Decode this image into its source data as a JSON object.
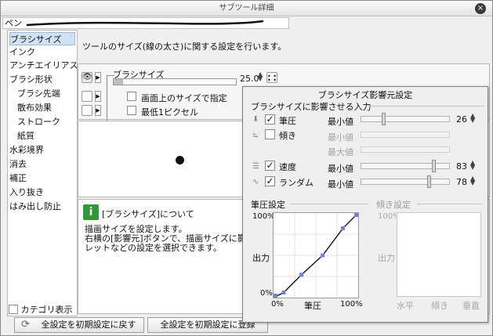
{
  "window": {
    "title": "サブツール詳細",
    "close_glyph": "×",
    "stroke_preview_label": "ペン"
  },
  "categories": {
    "items": [
      {
        "label": "ブラシサイズ"
      },
      {
        "label": "インク"
      },
      {
        "label": "アンチエイリアス"
      },
      {
        "label": "ブラシ形状"
      },
      {
        "label": "ブラシ先端"
      },
      {
        "label": "散布効果"
      },
      {
        "label": "ストローク"
      },
      {
        "label": "紙質"
      },
      {
        "label": "水彩境界"
      },
      {
        "label": "消去"
      },
      {
        "label": "補正"
      },
      {
        "label": "入り抜き"
      },
      {
        "label": "はみ出し防止"
      }
    ],
    "show_category_label": "カテゴリ表示"
  },
  "panel": {
    "description": "ツールのサイズ(線の太さ)に関する設定を行います。",
    "brush_size_label": "ブラシサイズ",
    "brush_size_value": "25.0",
    "brush_size_fraction": 0.08,
    "option_screen_size": "画面上のサイズで指定",
    "option_min_pixel": "最低1ピクセル",
    "help_title": "[ブラシサイズ]について",
    "help_line1": "描画サイズを設定します。",
    "help_line2": "右横の[影響元]ボタンで、描画サイズに影響",
    "help_line3": "レットなどの設定を選択できます。"
  },
  "bottom": {
    "reset_label": "全設定を初期設定に戻す",
    "register_label": "全設定を初期設定に登録"
  },
  "popup": {
    "title": "ブラシサイズ影響元設定",
    "section_label": "ブラシサイズに影響させる入力",
    "rows": [
      {
        "name": "筆圧",
        "checked": true,
        "min_label": "最小値",
        "value": "26",
        "fraction": 0.26,
        "icon": "pen-pressure-icon"
      },
      {
        "name": "傾き",
        "checked": false,
        "min_label": "最小値",
        "max_label": "最大値",
        "icon": "tilt-icon"
      },
      {
        "name": "速度",
        "checked": true,
        "min_label": "最小値",
        "value": "83",
        "fraction": 0.83,
        "icon": "velocity-icon"
      },
      {
        "name": "ランダム",
        "checked": true,
        "min_label": "最小値",
        "value": "78",
        "fraction": 0.78,
        "icon": "random-icon"
      }
    ],
    "pressure_graph": {
      "title": "筆圧設定",
      "y_top": "100%",
      "y_bottom": "0%",
      "y_label": "出力",
      "x_left": "0%",
      "x_mid": "筆圧",
      "x_right": "100%",
      "control_points": [
        [
          0,
          0
        ],
        [
          0.12,
          0.06
        ],
        [
          0.33,
          0.27
        ],
        [
          0.58,
          0.5
        ],
        [
          0.82,
          0.82
        ],
        [
          1,
          1
        ]
      ]
    },
    "tilt_graph": {
      "title": "傾き設定",
      "y_top": "100%",
      "y_label": "出力",
      "x_left": "水平",
      "x_mid": "傾き",
      "x_right": "垂直"
    }
  },
  "colors": {
    "accent": "#2f9a3a",
    "selection": "#cfe3f5",
    "curve_point": "#6f7fe6"
  }
}
